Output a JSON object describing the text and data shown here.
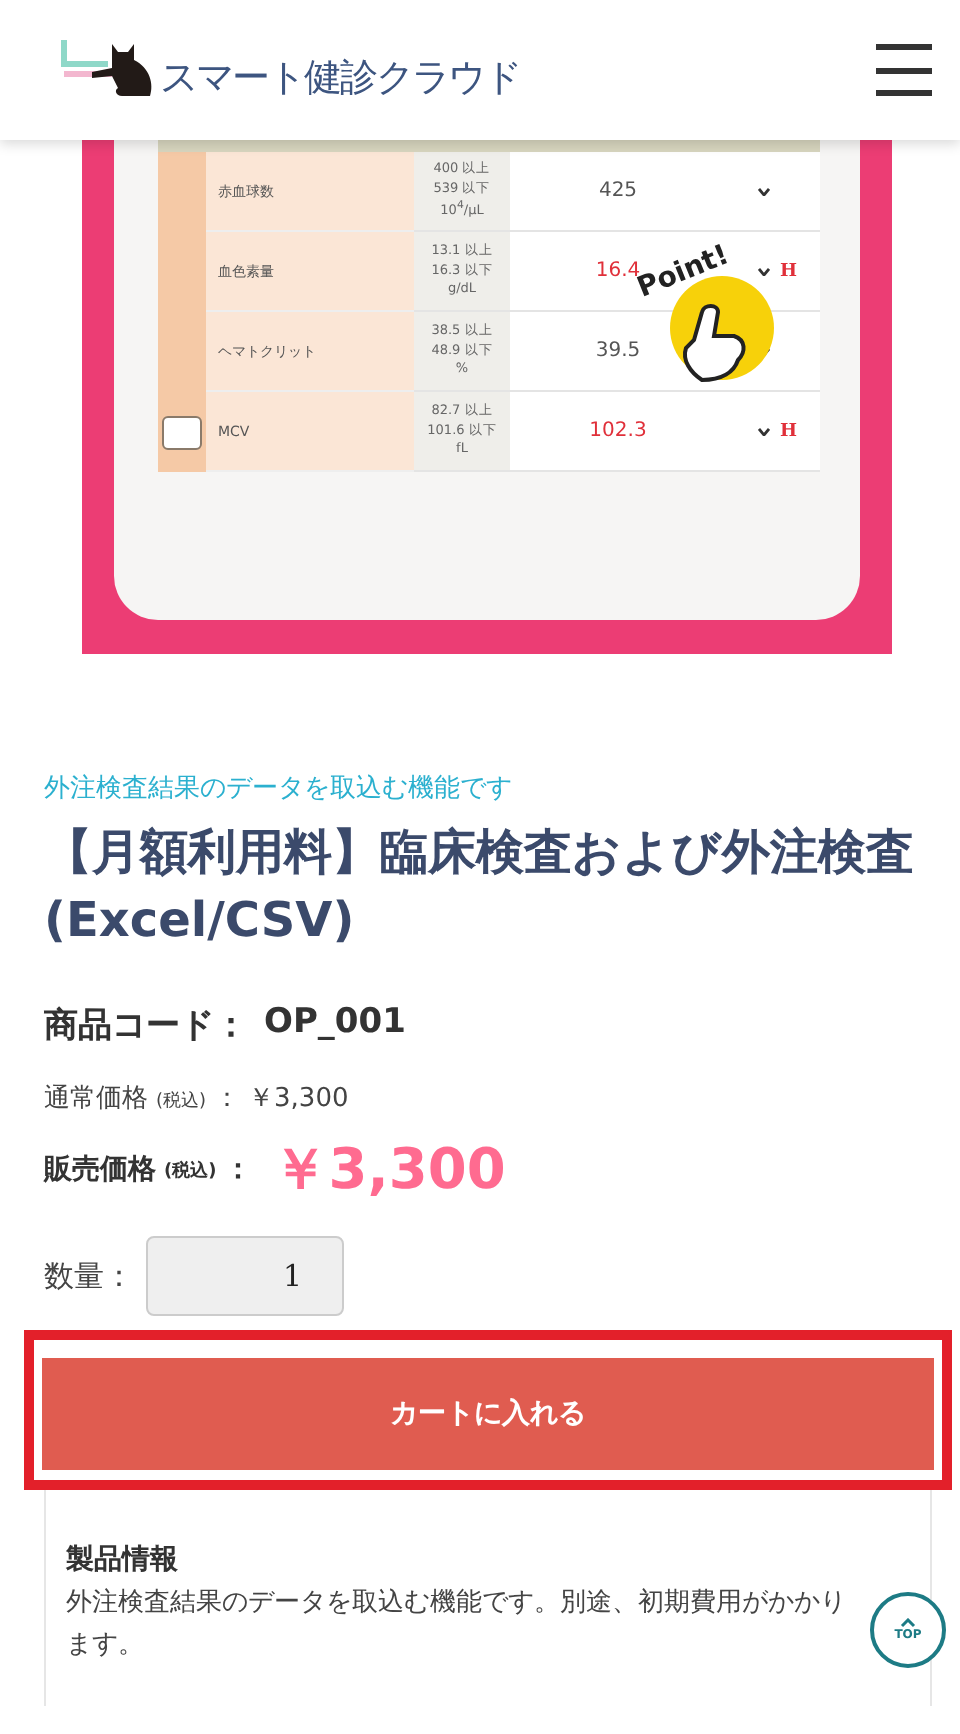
{
  "header": {
    "logo_text": "スマート健診クラウド"
  },
  "product_image": {
    "badge": "Point!",
    "rows": [
      {
        "name": "赤血球数",
        "range": [
          "400 以上",
          "539 以下",
          "10$^{4}$/μL"
        ],
        "value": "425",
        "high": false
      },
      {
        "name": "血色素量",
        "range": [
          "13.1 以上",
          "16.3 以下",
          "g/dL"
        ],
        "value": "16.4",
        "high": true,
        "flag": "H"
      },
      {
        "name": "ヘマトクリット",
        "range": [
          "38.5 以上",
          "48.9 以下",
          "%"
        ],
        "value": "39.5",
        "high": false
      },
      {
        "name": "MCV",
        "range": [
          "82.7 以上",
          "101.6 以下",
          "fL"
        ],
        "value": "102.3",
        "high": true,
        "flag": "H",
        "checkbox": {
          "checked": false
        }
      }
    ]
  },
  "catch_copy": "外注検査結果のデータを取込む機能です",
  "title": "【月額利用料】臨床検査および外注検査\n(Excel/CSV)",
  "product_code": {
    "label": "商品コード：",
    "value": "OP_001"
  },
  "regular_price": {
    "label": "通常価格",
    "tax": "(税込)",
    "colon": "：",
    "value": "￥3,300"
  },
  "sale_price": {
    "label": "販売価格",
    "tax": "(税込)",
    "colon": "：",
    "value": "￥3,300"
  },
  "quantity": {
    "label": "数量：",
    "value": "1"
  },
  "add_to_cart": {
    "label": "カートに入れる",
    "highlighted": true
  },
  "info": {
    "heading": "製品情報",
    "text": "外注検査結果のデータを取込む機能です。別途、初期費用がかかります。"
  },
  "top_button": {
    "label": "TOP"
  }
}
